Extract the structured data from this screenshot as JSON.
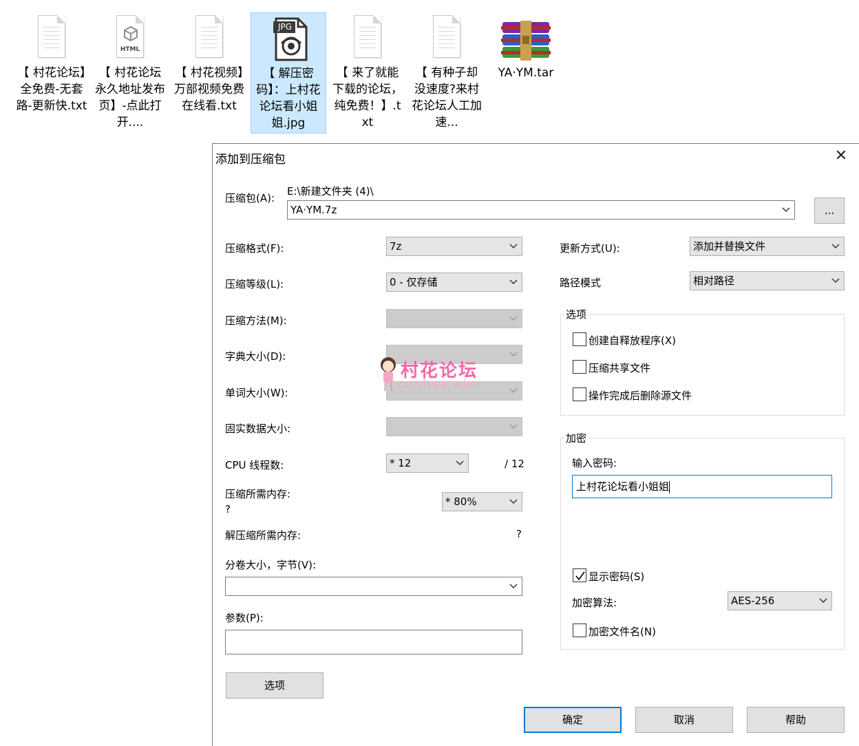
{
  "desktop": {
    "files": [
      {
        "name": "【 村花论坛】全免费-无套路-更新快.txt",
        "icon": "text-file-icon"
      },
      {
        "name": "【 村花论坛永久地址发布页】-点此打开....",
        "icon": "html-file-icon",
        "badge": "HTML"
      },
      {
        "name": "【 村花视频】万部视频免费在线看.txt",
        "icon": "text-file-icon"
      },
      {
        "name": "【 解压密码】：上村花论坛看小姐姐.jpg",
        "icon": "jpg-file-icon",
        "badge": "JPG",
        "selected": true
      },
      {
        "name": "【 来了就能下载的论坛，纯免费！】.txt",
        "icon": "text-file-icon"
      },
      {
        "name": "【 有种子却没速度?来村花论坛人工加速...",
        "icon": "text-file-icon"
      },
      {
        "name": "YA·YM.tar",
        "icon": "winrar-archive-icon"
      }
    ]
  },
  "dialog": {
    "title": "添加到压缩包",
    "archive": {
      "label": "压缩包(A):",
      "path": "E:\\新建文件夹 (4)\\",
      "value": "YA·YM.7z",
      "browse": "..."
    },
    "left": {
      "format": {
        "label": "压缩格式(F):",
        "value": "7z"
      },
      "level": {
        "label": "压缩等级(L):",
        "value": "0 - 仅存储"
      },
      "method": {
        "label": "压缩方法(M):",
        "value": ""
      },
      "dict": {
        "label": "字典大小(D):",
        "value": ""
      },
      "word": {
        "label": "单词大小(W):",
        "value": ""
      },
      "solid": {
        "label": "固实数据大小:",
        "value": ""
      },
      "cpu": {
        "label": "CPU 线程数:",
        "value": "* 12",
        "max": "/ 12"
      },
      "mem": {
        "label": "压缩所需内存:",
        "value": "?",
        "pct": "* 80%"
      },
      "demem": {
        "label": "解压缩所需内存:",
        "value": "?"
      },
      "volume": {
        "label": "分卷大小，字节(V):",
        "value": ""
      },
      "params": {
        "label": "参数(P):",
        "value": ""
      },
      "options_button": "选项"
    },
    "right": {
      "update": {
        "label": "更新方式(U):",
        "value": "添加并替换文件"
      },
      "pathmode": {
        "label": "路径模式",
        "value": "相对路径"
      },
      "options": {
        "title": "选项",
        "sfx": {
          "label": "创建自释放程序(X)",
          "checked": false
        },
        "shared": {
          "label": "压缩共享文件",
          "checked": false
        },
        "delete": {
          "label": "操作完成后删除源文件",
          "checked": false
        }
      },
      "encryption": {
        "title": "加密",
        "pw_label": "输入密码:",
        "password": "上村花论坛看小姐姐",
        "show": {
          "label": "显示密码(S)",
          "checked": true
        },
        "algo_label": "加密算法:",
        "algo": "AES-256",
        "encnames": {
          "label": "加密文件名(N)",
          "checked": false
        }
      }
    },
    "buttons": {
      "ok": "确定",
      "cancel": "取消",
      "help": "帮助"
    }
  },
  "watermark": {
    "text": "村花论坛",
    "sub": "cunhua.win"
  },
  "colors": {
    "accent": "#0078d7",
    "selection": "#cce8ff",
    "watermark": "#f06aa8"
  }
}
